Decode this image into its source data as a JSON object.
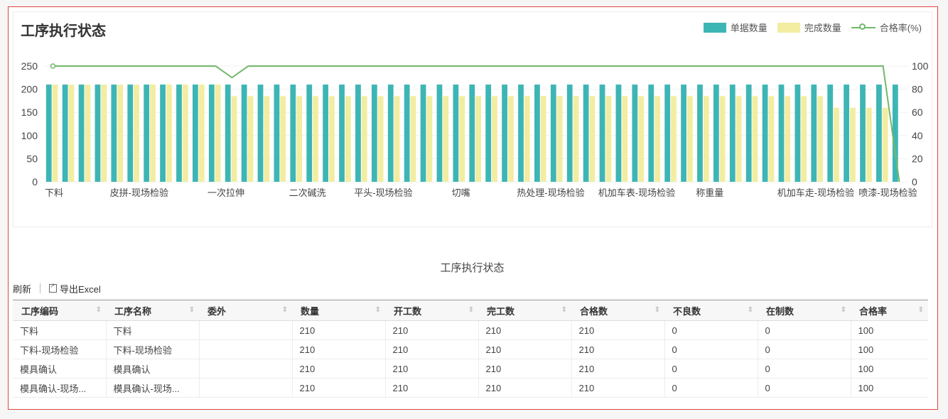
{
  "chart": {
    "title": "工序执行状态",
    "legend": [
      {
        "name": "单据数量",
        "color": "#3eb5b5"
      },
      {
        "name": "完成数量",
        "color": "#f2eda0"
      },
      {
        "name": "合格率(%)",
        "color": "#72b86a"
      }
    ]
  },
  "chart_data": {
    "type": "bar",
    "title": "工序执行状态",
    "xlabel": "",
    "ylabel": "",
    "ylim": [
      0,
      250
    ],
    "y2lim": [
      0,
      100
    ],
    "yticks": [
      "250",
      "200",
      "150",
      "100",
      "50",
      "0"
    ],
    "y2ticks": [
      "100",
      "80",
      "60",
      "40",
      "20",
      "0"
    ],
    "category_count": 53,
    "tick_labels": [
      {
        "index": 0,
        "text": "下料"
      },
      {
        "index": 4,
        "text": "皮拼-现场检验"
      },
      {
        "index": 10,
        "text": "一次拉伸"
      },
      {
        "index": 15,
        "text": "二次碱洗"
      },
      {
        "index": 19,
        "text": "平头-现场检验"
      },
      {
        "index": 25,
        "text": "切嘴"
      },
      {
        "index": 29,
        "text": "热处理-现场检验"
      },
      {
        "index": 34,
        "text": "机加车表-现场检验"
      },
      {
        "index": 40,
        "text": "称重量"
      },
      {
        "index": 45,
        "text": "机加车走-现场检验"
      },
      {
        "index": 50,
        "text": "喷漆-现场检验"
      }
    ],
    "legend_position": "top-right",
    "grid": true,
    "series": [
      {
        "name": "单据数量",
        "axis": "left",
        "values": [
          210,
          210,
          210,
          210,
          210,
          210,
          210,
          210,
          210,
          210,
          210,
          210,
          210,
          210,
          210,
          210,
          210,
          210,
          210,
          210,
          210,
          210,
          210,
          210,
          210,
          210,
          210,
          210,
          210,
          210,
          210,
          210,
          210,
          210,
          210,
          210,
          210,
          210,
          210,
          210,
          210,
          210,
          210,
          210,
          210,
          210,
          210,
          210,
          210,
          210,
          210,
          210,
          210
        ]
      },
      {
        "name": "完成数量",
        "axis": "left",
        "values": [
          210,
          210,
          210,
          210,
          210,
          210,
          210,
          210,
          210,
          210,
          210,
          185,
          185,
          185,
          185,
          185,
          185,
          185,
          185,
          185,
          185,
          185,
          185,
          185,
          185,
          185,
          185,
          185,
          185,
          185,
          185,
          185,
          185,
          185,
          185,
          185,
          185,
          185,
          185,
          185,
          185,
          185,
          185,
          185,
          185,
          185,
          185,
          185,
          160,
          160,
          160,
          160,
          0
        ]
      },
      {
        "name": "合格率(%)",
        "axis": "right",
        "type": "line",
        "values": [
          100,
          100,
          100,
          100,
          100,
          100,
          100,
          100,
          100,
          100,
          100,
          90,
          100,
          100,
          100,
          100,
          100,
          100,
          100,
          100,
          100,
          100,
          100,
          100,
          100,
          100,
          100,
          100,
          100,
          100,
          100,
          100,
          100,
          100,
          100,
          100,
          100,
          100,
          100,
          100,
          100,
          100,
          100,
          100,
          100,
          100,
          100,
          100,
          100,
          100,
          100,
          100,
          0
        ]
      }
    ]
  },
  "table": {
    "title": "工序执行状态",
    "toolbar": {
      "refresh": "刷新",
      "export": "导出Excel"
    },
    "columns": [
      "工序编码",
      "工序名称",
      "委外",
      "数量",
      "开工数",
      "完工数",
      "合格数",
      "不良数",
      "在制数",
      "合格率"
    ],
    "rows": [
      [
        "下料",
        "下料",
        "",
        "210",
        "210",
        "210",
        "210",
        "0",
        "0",
        "100"
      ],
      [
        "下料-现场检验",
        "下料-现场检验",
        "",
        "210",
        "210",
        "210",
        "210",
        "0",
        "0",
        "100"
      ],
      [
        "模具确认",
        "模具确认",
        "",
        "210",
        "210",
        "210",
        "210",
        "0",
        "0",
        "100"
      ],
      [
        "模具确认-现场...",
        "模具确认-现场...",
        "",
        "210",
        "210",
        "210",
        "210",
        "0",
        "0",
        "100"
      ]
    ]
  }
}
